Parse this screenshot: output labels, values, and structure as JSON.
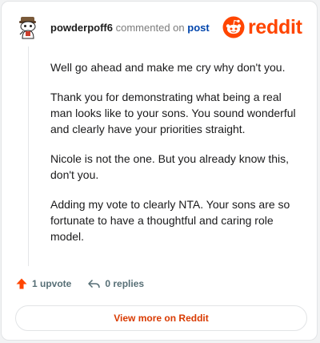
{
  "comment": {
    "username": "powderpoff6",
    "action_text": "commented on",
    "target_text": "post",
    "paragraphs": [
      "Well go ahead and make me cry why don't you.",
      "Thank you for demonstrating what being a real man looks like to your sons. You sound wonderful and clearly have your priorities straight.",
      "Nicole is not the one. But you already know this, don't you.",
      "Adding my vote to clearly NTA. Your sons are so fortunate to have a thoughtful and caring role model."
    ]
  },
  "brand": {
    "name": "reddit",
    "color": "#ff4500"
  },
  "actions": {
    "upvote_label": "1 upvote",
    "replies_label": "0 replies"
  },
  "footer": {
    "view_more_label": "View more on Reddit",
    "color": "#d93a00"
  }
}
